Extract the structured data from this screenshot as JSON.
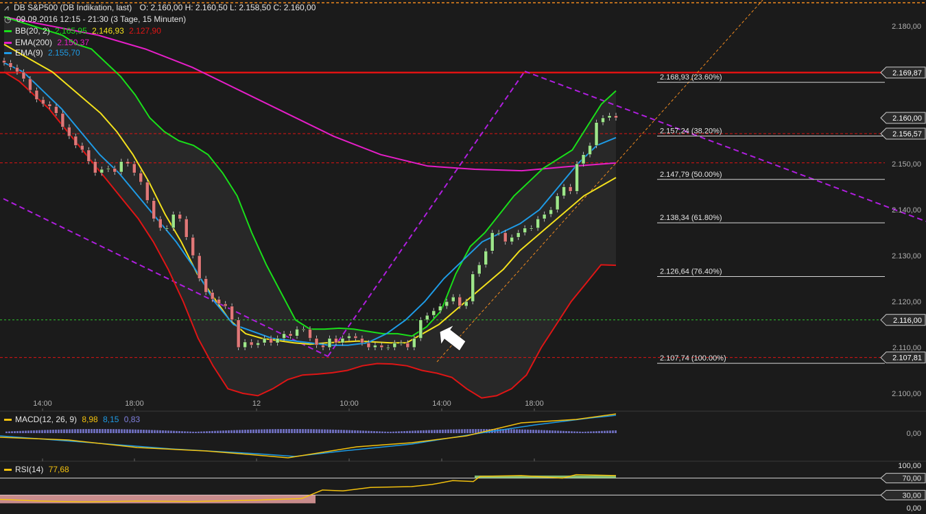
{
  "header": {
    "instrument": "DB S&P500 (DB Indikation, last)",
    "ohlc": "O: 2.160,00  H: 2.160,50  L: 2.158,50  C: 2.160,00",
    "period": "09.09.2016 12:15 - 21:30 (3 Tage, 15 Minuten)",
    "bb_label": "BB(20, 2)",
    "bb_upper": "2.165,95",
    "bb_mid": "2.146,93",
    "bb_lower": "2.127,90",
    "ema200_label": "EMA(200)",
    "ema200_value": "2.150,37",
    "ema9_label": "EMA(9)",
    "ema9_value": "2.155,70"
  },
  "colors": {
    "background": "#1b1b1b",
    "bb_upper": "#19e019",
    "bb_lower": "#e01515",
    "bb_mid": "#f4e21c",
    "ema200": "#e61ec8",
    "ema9": "#1e9be6",
    "candle_up": "#9ee68a",
    "candle_down": "#e07878",
    "resistance": "#e21212",
    "channel": "#b01ee0",
    "trend": "#f08a1e",
    "support": "#2ec82e",
    "macd_line": "#f4c20d",
    "macd_signal": "#1e9be6",
    "macd_hist": "#8080e0",
    "rsi_line": "#f4c20d"
  },
  "price_axis": {
    "ticks": [
      "2.180,00",
      "2.170,00",
      "2.160,00",
      "2.150,00",
      "2.140,00",
      "2.130,00",
      "2.120,00",
      "2.110,00",
      "2.100,00"
    ],
    "badges": [
      "2.169,87",
      "2.160,00",
      "2.156,57",
      "2.116,00",
      "2.107,81"
    ]
  },
  "time_axis": [
    "14:00",
    "18:00",
    "12",
    "10:00",
    "14:00",
    "18:00"
  ],
  "fibonacci": [
    {
      "label": "2.168,93 (23.60%)",
      "value": 2168.93
    },
    {
      "label": "2.157,24 (38.20%)",
      "value": 2157.24
    },
    {
      "label": "2.147,79 (50.00%)",
      "value": 2147.79
    },
    {
      "label": "2.138,34 (61.80%)",
      "value": 2138.34
    },
    {
      "label": "2.126,64 (76.40%)",
      "value": 2126.64
    },
    {
      "label": "2.107,74 (100.00%)",
      "value": 2107.74
    }
  ],
  "macd": {
    "label": "MACD(12, 26, 9)",
    "v1": "8,98",
    "v2": "8,15",
    "v3": "0,83",
    "axis_label": "0,00"
  },
  "rsi": {
    "label": "RSI(14)",
    "value": "77,68",
    "axis": [
      "100,00",
      "70,00",
      "30,00",
      "0,00"
    ]
  },
  "chart_data": {
    "type": "candlestick",
    "ylim": [
      2097,
      2185
    ],
    "candles_close": [
      2172,
      2171,
      2170,
      2168.5,
      2166,
      2164,
      2163,
      2162.5,
      2161,
      2158,
      2156,
      2154,
      2153,
      2150.5,
      2148,
      2148.8,
      2149,
      2148.2,
      2150.5,
      2150,
      2148,
      2146,
      2142,
      2138,
      2136,
      2136,
      2139,
      2138,
      2134,
      2130,
      2125,
      2122,
      2120.5,
      2119.5,
      2119,
      2116,
      2110,
      2111.2,
      2110.5,
      2111,
      2112,
      2111,
      2112,
      2113,
      2112.5,
      2114,
      2114,
      2112,
      2110.5,
      2110,
      2112,
      2111,
      2112,
      2112.5,
      2112,
      2111,
      2110,
      2110.5,
      2110,
      2110,
      2111,
      2111,
      2110,
      2112,
      2116,
      2117,
      2118,
      2119,
      2120,
      2121,
      2119,
      2120,
      2126,
      2128,
      2131,
      2135,
      2135,
      2133,
      2134,
      2135,
      2136,
      2136,
      2138,
      2139,
      2140,
      2143,
      2145,
      2144,
      2150,
      2152,
      2154,
      2159,
      2160,
      2160.5,
      2160
    ],
    "bb_upper": [
      2182,
      2181,
      2180,
      2179,
      2178,
      2176,
      2175,
      2172,
      2169,
      2165,
      2160,
      2157,
      2155,
      2154,
      2152,
      2148,
      2143,
      2135,
      2128,
      2122,
      2116,
      2114,
      2114,
      2114.2,
      2114,
      2113.5,
      2113,
      2113,
      2112.5,
      2114.5,
      2118,
      2126,
      2132,
      2135,
      2139,
      2143,
      2146,
      2149,
      2151,
      2153,
      2158,
      2163,
      2165.9
    ],
    "bb_lower": [
      2170,
      2168,
      2165,
      2162,
      2158,
      2154,
      2150,
      2146,
      2142,
      2138,
      2133,
      2127,
      2120,
      2112,
      2106,
      2101,
      2100,
      2099.5,
      2101,
      2103,
      2104,
      2104.2,
      2104.5,
      2105,
      2106,
      2106.5,
      2106.4,
      2106,
      2105,
      2104.4,
      2103.5,
      2101,
      2099,
      2099.5,
      2101,
      2104,
      2110,
      2115,
      2120,
      2124,
      2128,
      2127.9
    ],
    "bb_mid": [
      2176,
      2174,
      2172,
      2170,
      2167,
      2164,
      2161,
      2157,
      2152,
      2146,
      2139,
      2133,
      2126,
      2121,
      2116,
      2113,
      2112,
      2111.5,
      2111,
      2110.7,
      2111,
      2111.2,
      2111.4,
      2111.2,
      2111,
      2111,
      2113,
      2115,
      2118,
      2121,
      2124,
      2127,
      2131,
      2134,
      2137,
      2140,
      2143,
      2145,
      2147
    ],
    "ema200": [
      2182,
      2180,
      2178,
      2175,
      2171,
      2166,
      2161,
      2156,
      2152,
      2149.5,
      2148.8,
      2148.5,
      2149.4,
      2150.2
    ],
    "ema9": [
      2172,
      2170,
      2166,
      2162,
      2157,
      2152,
      2148,
      2143,
      2138,
      2133,
      2127,
      2120,
      2115,
      2113.5,
      2112,
      2111.5,
      2111,
      2110.5,
      2110.5,
      2111,
      2113,
      2116,
      2120,
      2125,
      2129,
      2133,
      2135,
      2137,
      2140,
      2145,
      2150,
      2154,
      2155.7
    ],
    "macd": {
      "v1": 8.98,
      "v2": 8.15,
      "v3": 0.83
    },
    "rsi": 77.68
  }
}
